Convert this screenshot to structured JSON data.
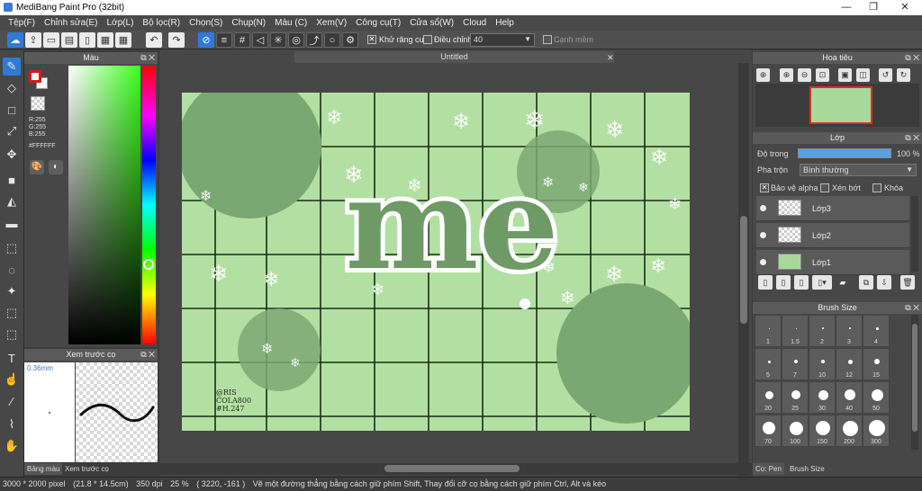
{
  "window": {
    "title": "MediBang Paint Pro (32bit)"
  },
  "menu": [
    "Tệp(F)",
    "Chỉnh sửa(E)",
    "Lớp(L)",
    "Bộ lọc(R)",
    "Chọn(S)",
    "Chụp(N)",
    "Màu (C)",
    "Xem(V)",
    "Công cụ(T)",
    "Cửa sổ(W)",
    "Cloud",
    "Help"
  ],
  "toolbar": {
    "antialias_label": "Khử răng cưa",
    "adjust_label": "Điều chỉnh",
    "adjust_value": "40",
    "edge_label": "Cạnh mềm"
  },
  "color_panel": {
    "title": "Màu",
    "r": "R:255",
    "g": "G:255",
    "b": "B:255",
    "hex": "#FFFFFF",
    "fg_color": "#e1141c",
    "bg_color": "#ffffff"
  },
  "brush_preview": {
    "title": "Xem trước cọ",
    "size": "0.36mm"
  },
  "left_bottom_tabs": [
    "Bảng màu",
    "Xem trước cọ"
  ],
  "document": {
    "tab": "Untitled"
  },
  "canvas_art": {
    "title_text": "me",
    "signature": [
      "@RIS",
      "COLA800",
      "#H.247"
    ],
    "bg_color": "#b2e0a3",
    "shape_color": "#7aa872"
  },
  "navigator": {
    "title": "Hoa tiêu"
  },
  "layers": {
    "title": "Lớp",
    "opacity_label": "Độ trong",
    "opacity_value": "100 %",
    "opacity_fraction": 1.0,
    "blend_label": "Pha trộn",
    "blend_value": "Bình thường",
    "protect_alpha": "Bảo vệ alpha",
    "clipping": "Xén bớt",
    "lock": "Khóa",
    "items": [
      {
        "name": "Lớp3",
        "green": false
      },
      {
        "name": "Lớp2",
        "green": false
      },
      {
        "name": "Lớp1",
        "green": true
      }
    ]
  },
  "brush_size": {
    "title": "Brush Size",
    "sizes": [
      "1",
      "1.5",
      "2",
      "3",
      "4",
      "5",
      "7",
      "10",
      "12",
      "15",
      "20",
      "25",
      "30",
      "40",
      "50",
      "70",
      "100",
      "150",
      "200",
      "300"
    ]
  },
  "right_bottom_tabs": [
    "Cọ: Pen",
    "Brush Size"
  ],
  "status": {
    "pixels": "3000 * 2000 pixel",
    "physical": "(21.8 * 14.5cm)",
    "dpi": "350 dpi",
    "zoom": "25 %",
    "coords": "( 3220, -161 )",
    "hint": "Vẽ một đường thẳng bằng cách giữ phím Shift, Thay đổi cỡ cọ bằng cách giữ phím Ctrl, Alt và kéo"
  }
}
